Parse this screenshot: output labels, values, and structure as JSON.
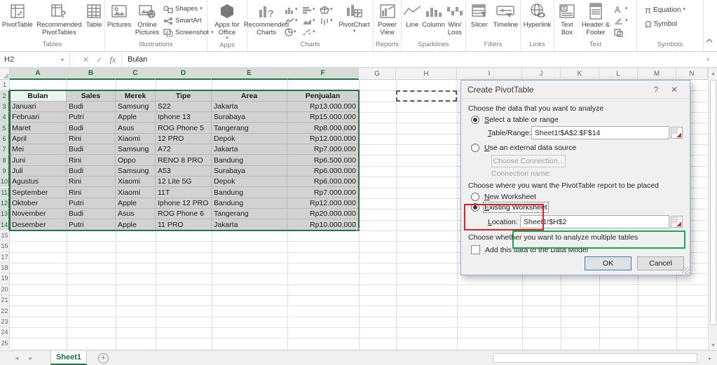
{
  "colors": {
    "accent_green": "#217346",
    "annotation_red": "#e02020",
    "annotation_green": "#18ab4e",
    "selection_fill": "#d2d2d2",
    "dialog_bg": "#f0f0f0"
  },
  "icons": {
    "dropdown": "▾",
    "help": "?",
    "close": "✕",
    "name_box_dropdown": "▾",
    "cancel_x": "✕",
    "enter_check": "✓",
    "fx": "fx",
    "formula_expand": "˅",
    "dots": "⋮",
    "tab_left": "◂",
    "tab_right": "▸",
    "new_sheet": "+",
    "scroll_up": "▴",
    "scroll_down": "▾",
    "scroll_right": "▸",
    "equation_pi": "π",
    "symbol_omega": "Ω"
  },
  "ribbon": {
    "tables": {
      "label": "Tables",
      "pivottable": "PivotTable",
      "recommended_pivottables": "Recommended PivotTables",
      "table": "Table"
    },
    "illustrations": {
      "label": "Illustrations",
      "pictures": "Pictures",
      "online_pictures": "Online Pictures",
      "shapes": "Shapes",
      "smartart": "SmartArt",
      "screenshot": "Screenshot"
    },
    "apps": {
      "label": "Apps",
      "apps_for_office": "Apps for Office"
    },
    "charts": {
      "label": "Charts",
      "recommended_charts": "Recommended Charts",
      "pivotchart": "PivotChart"
    },
    "reports": {
      "label": "Reports",
      "power_view": "Power View"
    },
    "sparklines": {
      "label": "Sparklines",
      "line": "Line",
      "column": "Column",
      "win_loss": "Win/ Loss"
    },
    "filters": {
      "label": "Filters",
      "slicer": "Slicer",
      "timeline": "Timeline"
    },
    "links": {
      "label": "Links",
      "hyperlink": "Hyperlink"
    },
    "text": {
      "label": "Text",
      "text_box": "Text Box",
      "header_footer": "Header & Footer"
    },
    "symbols": {
      "label": "Symbols",
      "equation": "Equation",
      "symbol": "Symbol"
    }
  },
  "formula_bar": {
    "name_box": "H2",
    "formula": "Bulan"
  },
  "sheet": {
    "tab": "Sheet1",
    "columns": [
      "A",
      "B",
      "C",
      "D",
      "E",
      "F",
      "G",
      "H",
      "I",
      "J",
      "K",
      "L",
      "M",
      "N"
    ],
    "row_count": 25,
    "selection_range": "A2:F14",
    "marquee_cell": "H2",
    "table": {
      "headers": [
        "Bulan",
        "Sales",
        "Merek",
        "Tipe",
        "Area",
        "Penjualan"
      ],
      "rows": [
        [
          "Januari",
          "Budi",
          "Samsung",
          "S22",
          "Jakarta",
          "Rp13.000.000"
        ],
        [
          "Februari",
          "Putri",
          "Apple",
          "Iphone 13",
          "Surabaya",
          "Rp15.000.000"
        ],
        [
          "Maret",
          "Budi",
          "Asus",
          "ROG Phone 5",
          "Tangerang",
          "Rp8.000.000"
        ],
        [
          "April",
          "Rini",
          "Xiaomi",
          "12 PRO",
          "Depok",
          "Rp12.000.000"
        ],
        [
          "Mei",
          "Budi",
          "Samsung",
          "A72",
          "Jakarta",
          "Rp7.000.000"
        ],
        [
          "Juni",
          "Rini",
          "Oppo",
          "RENO 8 PRO",
          "Bandung",
          "Rp6.500.000"
        ],
        [
          "Juli",
          "Budi",
          "Samsung",
          "A53",
          "Surabaya",
          "Rp6.000.000"
        ],
        [
          "Agustus",
          "Rini",
          "Xiaomi",
          "12 Lite 5G",
          "Depok",
          "Rp6.000.000"
        ],
        [
          "September",
          "Rini",
          "Xiaomi",
          "11T",
          "Bandung",
          "Rp7.000.000"
        ],
        [
          "Oktober",
          "Putri",
          "Apple",
          "Iphone 12 PRO",
          "Bandung",
          "Rp12.000.000"
        ],
        [
          "November",
          "Budi",
          "Asus",
          "ROG Phone 6",
          "Tangerang",
          "Rp20.000.000"
        ],
        [
          "Desember",
          "Putri",
          "Apple",
          "11 PRO",
          "Jakarta",
          "Rp10.000.000"
        ]
      ]
    }
  },
  "dialog": {
    "title": "Create PivotTable",
    "section_analyze": "Choose the data that you want to analyze",
    "radio_select_table": "Select a table or range",
    "table_range_label": "Table/Range:",
    "table_range_value": "Sheet1!$A$2:$F$14",
    "radio_external": "Use an external data source",
    "choose_connection_button": "Choose Connection...",
    "connection_name_label": "Connection name:",
    "section_place": "Choose where you want the PivotTable report to be placed",
    "radio_new_worksheet": "New Worksheet",
    "radio_existing_worksheet": "Existing Worksheet",
    "location_label": "Location:",
    "location_value": "Sheet1!$H$2",
    "section_multiple": "Choose whether you want to analyze multiple tables",
    "checkbox_data_model": "Add this data to the Data Model",
    "ok_button": "OK",
    "cancel_button": "Cancel"
  }
}
